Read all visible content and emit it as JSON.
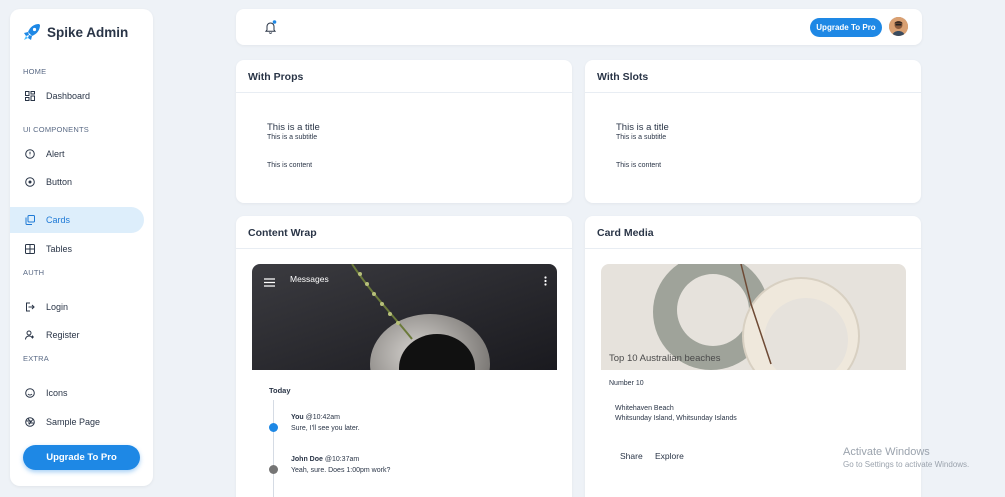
{
  "brand": {
    "name": "Spike Admin"
  },
  "sidebar": {
    "sections": [
      {
        "label": "HOME"
      },
      {
        "label": "UI COMPONENTS"
      },
      {
        "label": "AUTH"
      },
      {
        "label": "EXTRA"
      }
    ],
    "items": [
      {
        "label": "Dashboard",
        "icon": "dashboard-icon"
      },
      {
        "label": "Alert",
        "icon": "alert-circle-icon"
      },
      {
        "label": "Button",
        "icon": "circle-dot-icon"
      },
      {
        "label": "Cards",
        "icon": "cards-icon",
        "active": true
      },
      {
        "label": "Tables",
        "icon": "table-icon"
      },
      {
        "label": "Login",
        "icon": "login-icon"
      },
      {
        "label": "Register",
        "icon": "user-plus-icon"
      },
      {
        "label": "Icons",
        "icon": "mood-icon"
      },
      {
        "label": "Sample Page",
        "icon": "aperture-icon"
      }
    ],
    "upgrade_label": "Upgrade To Pro"
  },
  "topbar": {
    "upgrade_label": "Upgrade To Pro",
    "notification_icon": "bell-icon",
    "accent": "#1e88e5"
  },
  "cards": {
    "with_props": {
      "heading": "With Props",
      "title": "This is a title",
      "subtitle": "This is a subtitle",
      "content": "This is content"
    },
    "with_slots": {
      "heading": "With Slots",
      "title": "This is a title",
      "subtitle": "This is a subtitle",
      "content": "This is content"
    },
    "content_wrap": {
      "heading": "Content Wrap",
      "toolbar_title": "Messages",
      "timeline_heading": "Today",
      "entries": [
        {
          "name": "You",
          "time": "@10:42am",
          "text": "Sure, I'll see you later.",
          "color": "#1e88e5"
        },
        {
          "name": "John Doe",
          "time": "@10:37am",
          "text": "Yeah, sure. Does 1:00pm work?",
          "color": "#757575"
        }
      ]
    },
    "card_media": {
      "heading": "Card Media",
      "image_title": "Top 10 Australian beaches",
      "chip": "Number 10",
      "line1": "Whitehaven Beach",
      "line2": "Whitsunday Island, Whitsunday Islands",
      "actions": [
        "Share",
        "Explore"
      ]
    }
  },
  "watermark": {
    "line1": "Activate Windows",
    "line2": "Go to Settings to activate Windows."
  }
}
